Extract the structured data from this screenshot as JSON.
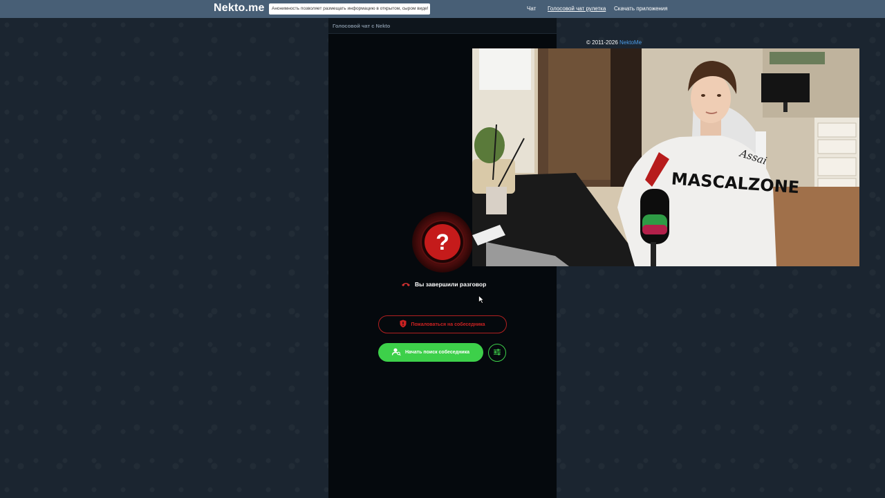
{
  "header": {
    "logo": "Nekto.me",
    "notice": "Анонимность позволяет размещать информацию в открытом, сыром виде!",
    "nav": [
      "Чат",
      "Голосовой чат рулетка",
      "Скачать приложения"
    ]
  },
  "panel": {
    "title": "Голосовой чат с Nekto",
    "avatar_symbol": "?",
    "status": "Вы завершили разговор",
    "report_button": "Пожаловаться на собеседника",
    "search_button": "Начать поиск собеседника"
  },
  "footer": {
    "copyright": "© 2011-2026",
    "copyright_link": "NektoMe"
  },
  "video": {
    "hoodie_text": "MASCALZONE",
    "brand_text": "Assai"
  },
  "colors": {
    "topbar": "#485f76",
    "background": "#1b2530",
    "panel": "#05090d",
    "accent_green": "#3dd04a",
    "accent_red": "#c51b1b",
    "link": "#4b9be6"
  },
  "icons": [
    "hangup-icon",
    "shield-icon",
    "user-search-icon",
    "sliders-icon",
    "cursor-icon"
  ]
}
